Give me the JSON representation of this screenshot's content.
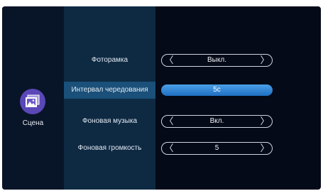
{
  "sidebar": {
    "icon": "picture-frame-icon",
    "label": "Сцена"
  },
  "settings": [
    {
      "label": "Фоторамка",
      "value": "Выкл.",
      "left_arrow": "〈",
      "right_arrow": "〉"
    },
    {
      "label": "Интервал чередования",
      "value": "5с",
      "left_arrow": "",
      "right_arrow": ""
    },
    {
      "label": "Фоновая музыка",
      "value": "Вкл.",
      "left_arrow": "〈",
      "right_arrow": "〉"
    },
    {
      "label": "Фоновая громкость",
      "value": "5",
      "left_arrow": "〈",
      "right_arrow": "〉"
    }
  ],
  "colors": {
    "accent": "#2e86d6",
    "background": "#040a17",
    "highlight": "#1a5079",
    "icon_bg": "#5a47b8"
  }
}
